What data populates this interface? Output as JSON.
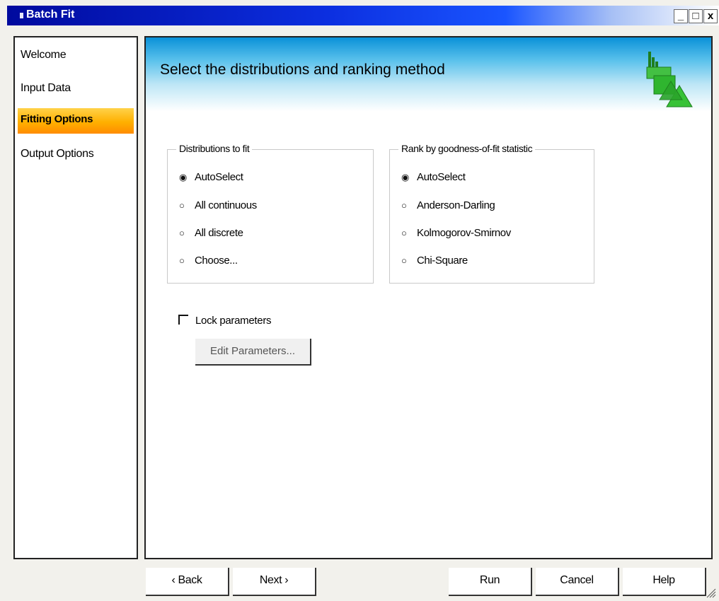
{
  "window": {
    "title": "Batch Fit",
    "controls": {
      "minimize": "_",
      "maximize": "□",
      "close": "x"
    }
  },
  "sidebar": {
    "items": [
      {
        "label": "Welcome",
        "selected": false
      },
      {
        "label": "Input Data",
        "selected": false
      },
      {
        "label": "Fitting Options",
        "selected": true
      },
      {
        "label": "Output Options",
        "selected": false
      }
    ],
    "selected_color": "#ffb000"
  },
  "header": {
    "title": "Select the distributions and ranking method",
    "logo_icon": "distribution-fit-logo-icon",
    "logo_color": "#2fb52f"
  },
  "distributions_group": {
    "legend": "Distributions to fit",
    "options": [
      {
        "label": "AutoSelect",
        "checked": true
      },
      {
        "label": "All continuous",
        "checked": false
      },
      {
        "label": "All discrete",
        "checked": false
      },
      {
        "label": "Choose...",
        "checked": false
      }
    ]
  },
  "rank_group": {
    "legend": "Rank by goodness-of-fit statistic",
    "options": [
      {
        "label": "AutoSelect",
        "checked": true
      },
      {
        "label": "Anderson-Darling",
        "checked": false
      },
      {
        "label": "Kolmogorov-Smirnov",
        "checked": false
      },
      {
        "label": "Chi-Square",
        "checked": false
      }
    ]
  },
  "lock_parameters": {
    "label": "Lock parameters",
    "checked": false
  },
  "edit_parameters_label": "Edit Parameters...",
  "buttons": {
    "back": "‹ Back",
    "next": "Next ›",
    "run": "Run",
    "cancel": "Cancel",
    "help": "Help"
  }
}
